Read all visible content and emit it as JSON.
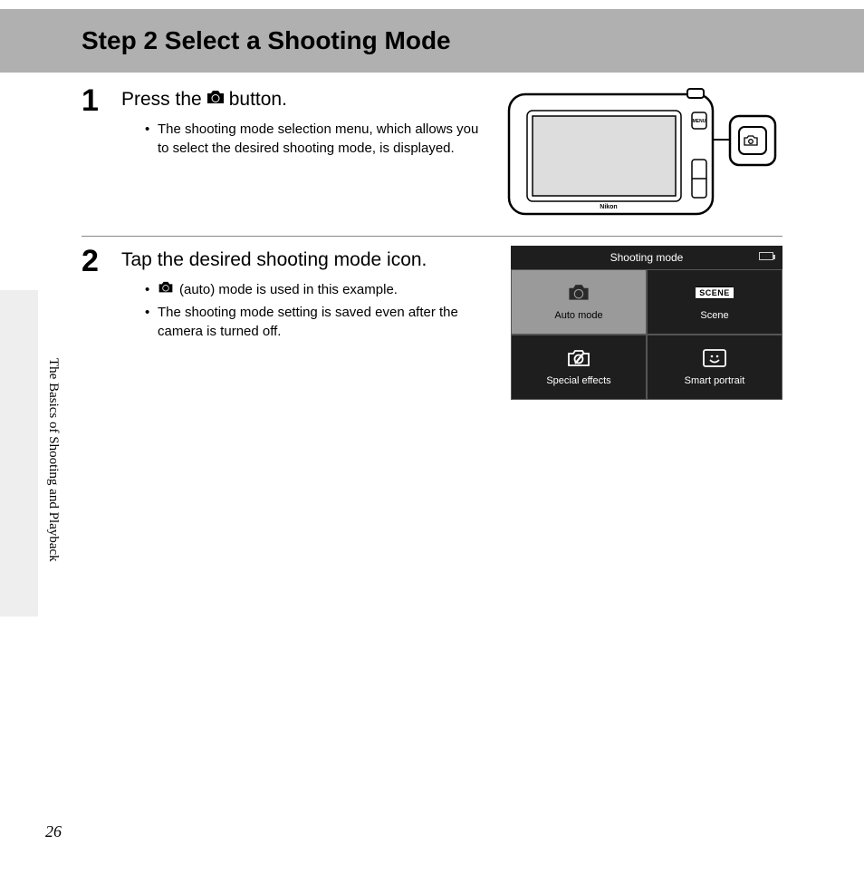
{
  "header": {
    "title": "Step 2 Select a Shooting Mode"
  },
  "sidebar": {
    "section_label": "The Basics of Shooting and Playback"
  },
  "page_number": "26",
  "steps": {
    "s1": {
      "num": "1",
      "title_pre": "Press the ",
      "title_post": " button.",
      "bullets": [
        "The shooting mode selection menu, which allows you to select the desired shooting mode, is displayed."
      ]
    },
    "s2": {
      "num": "2",
      "title": "Tap the desired shooting mode icon.",
      "bullet1_post": " (auto) mode is used in this example.",
      "bullet2": "The shooting mode setting is saved even after the camera is turned off."
    }
  },
  "mode_menu": {
    "title": "Shooting mode",
    "cells": {
      "auto": "Auto mode",
      "scene": "Scene",
      "scene_badge": "SCENE",
      "effects": "Special effects",
      "portrait": "Smart portrait"
    }
  }
}
